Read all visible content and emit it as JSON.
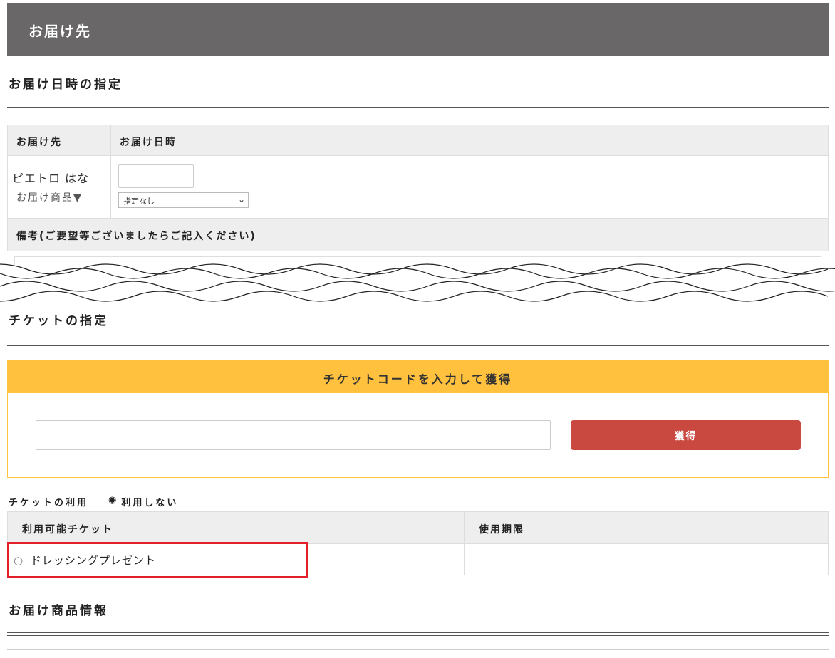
{
  "header": {
    "title": "お届け先"
  },
  "delivery_section": {
    "title": "お届け日時の指定",
    "table": {
      "col_recipient": "お届け先",
      "col_datetime": "お届け日時",
      "recipient_name": "ピエトロ はな",
      "goods_toggle": "お届け商品▼",
      "date_value": "",
      "time_select": "指定なし",
      "notes_label": "備考(ご要望等ございましたらご記入ください)"
    }
  },
  "ticket_section": {
    "title": "チケットの指定",
    "code_box_title": "チケットコードを入力して獲得",
    "code_input_value": "",
    "acquire_button": "獲得",
    "use_label": "チケットの利用",
    "use_option": "利用しない",
    "use_option_icon": "◉",
    "table": {
      "col_available": "利用可能チケット",
      "col_expiry": "使用期限",
      "rows": [
        {
          "radio": "○",
          "name": "ドレッシングプレゼント",
          "expiry": ""
        }
      ]
    }
  },
  "goods_section": {
    "title": "お届け商品情報"
  },
  "colors": {
    "header_bg": "#696767",
    "ticket_accent": "#ffc13e",
    "button_red": "#c94840",
    "highlight_red": "#e3202a"
  }
}
